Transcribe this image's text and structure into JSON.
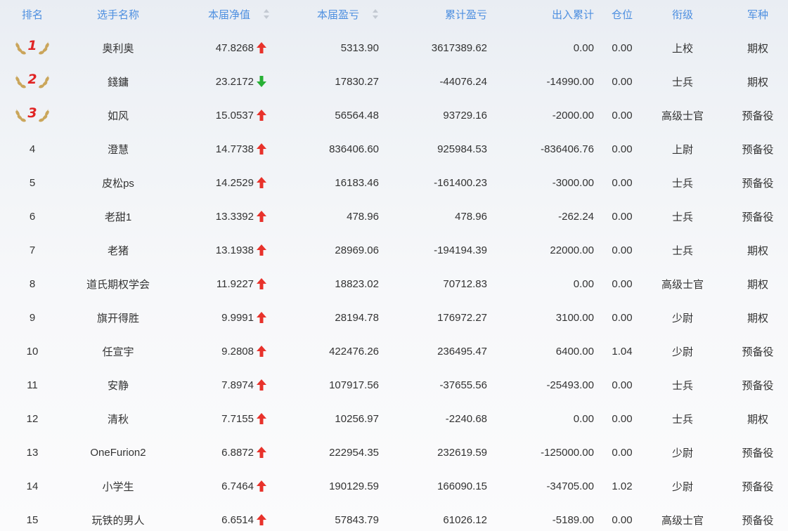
{
  "headers": {
    "rank": "排名",
    "name": "选手名称",
    "net_value": "本届净值",
    "profit_loss": "本届盈亏",
    "cumulative_pl": "累计盈亏",
    "flow": "出入累计",
    "position": "仓位",
    "military_rank": "衔级",
    "arm": "军种"
  },
  "icons": {
    "sort": "sort-icon",
    "up": "arrow-up-icon",
    "down": "arrow-down-icon",
    "medal": "laurel-medal-icon"
  },
  "colors": {
    "header_text": "#4d8fe0",
    "arrow_up": "#e8322b",
    "arrow_down": "#27b035",
    "medal_number": "#e02424",
    "laurel": "#c9a253"
  },
  "rows": [
    {
      "rank": "1",
      "name": "奥利奥",
      "net_value": "47.8268",
      "trend": "up",
      "profit_loss": "5313.90",
      "cumulative_pl": "3617389.62",
      "flow": "0.00",
      "position": "0.00",
      "military_rank": "上校",
      "arm": "期权"
    },
    {
      "rank": "2",
      "name": "錢鏞",
      "net_value": "23.2172",
      "trend": "down",
      "profit_loss": "17830.27",
      "cumulative_pl": "-44076.24",
      "flow": "-14990.00",
      "position": "0.00",
      "military_rank": "士兵",
      "arm": "期权"
    },
    {
      "rank": "3",
      "name": "如风",
      "net_value": "15.0537",
      "trend": "up",
      "profit_loss": "56564.48",
      "cumulative_pl": "93729.16",
      "flow": "-2000.00",
      "position": "0.00",
      "military_rank": "高级士官",
      "arm": "预备役"
    },
    {
      "rank": "4",
      "name": "澄慧",
      "net_value": "14.7738",
      "trend": "up",
      "profit_loss": "836406.60",
      "cumulative_pl": "925984.53",
      "flow": "-836406.76",
      "position": "0.00",
      "military_rank": "上尉",
      "arm": "预备役"
    },
    {
      "rank": "5",
      "name": "皮松ps",
      "net_value": "14.2529",
      "trend": "up",
      "profit_loss": "16183.46",
      "cumulative_pl": "-161400.23",
      "flow": "-3000.00",
      "position": "0.00",
      "military_rank": "士兵",
      "arm": "预备役"
    },
    {
      "rank": "6",
      "name": "老甜1",
      "net_value": "13.3392",
      "trend": "up",
      "profit_loss": "478.96",
      "cumulative_pl": "478.96",
      "flow": "-262.24",
      "position": "0.00",
      "military_rank": "士兵",
      "arm": "预备役"
    },
    {
      "rank": "7",
      "name": "老猪",
      "net_value": "13.1938",
      "trend": "up",
      "profit_loss": "28969.06",
      "cumulative_pl": "-194194.39",
      "flow": "22000.00",
      "position": "0.00",
      "military_rank": "士兵",
      "arm": "期权"
    },
    {
      "rank": "8",
      "name": "道氏期权学会",
      "net_value": "11.9227",
      "trend": "up",
      "profit_loss": "18823.02",
      "cumulative_pl": "70712.83",
      "flow": "0.00",
      "position": "0.00",
      "military_rank": "高级士官",
      "arm": "期权"
    },
    {
      "rank": "9",
      "name": "旗开得胜",
      "net_value": "9.9991",
      "trend": "up",
      "profit_loss": "28194.78",
      "cumulative_pl": "176972.27",
      "flow": "3100.00",
      "position": "0.00",
      "military_rank": "少尉",
      "arm": "期权"
    },
    {
      "rank": "10",
      "name": "任宣宇",
      "net_value": "9.2808",
      "trend": "up",
      "profit_loss": "422476.26",
      "cumulative_pl": "236495.47",
      "flow": "6400.00",
      "position": "1.04",
      "military_rank": "少尉",
      "arm": "预备役"
    },
    {
      "rank": "11",
      "name": "安静",
      "net_value": "7.8974",
      "trend": "up",
      "profit_loss": "107917.56",
      "cumulative_pl": "-37655.56",
      "flow": "-25493.00",
      "position": "0.00",
      "military_rank": "士兵",
      "arm": "预备役"
    },
    {
      "rank": "12",
      "name": "清秋",
      "net_value": "7.7155",
      "trend": "up",
      "profit_loss": "10256.97",
      "cumulative_pl": "-2240.68",
      "flow": "0.00",
      "position": "0.00",
      "military_rank": "士兵",
      "arm": "期权"
    },
    {
      "rank": "13",
      "name": "OneFurion2",
      "net_value": "6.8872",
      "trend": "up",
      "profit_loss": "222954.35",
      "cumulative_pl": "232619.59",
      "flow": "-125000.00",
      "position": "0.00",
      "military_rank": "少尉",
      "arm": "预备役"
    },
    {
      "rank": "14",
      "name": "小学生",
      "net_value": "6.7464",
      "trend": "up",
      "profit_loss": "190129.59",
      "cumulative_pl": "166090.15",
      "flow": "-34705.00",
      "position": "1.02",
      "military_rank": "少尉",
      "arm": "预备役"
    },
    {
      "rank": "15",
      "name": "玩铁的男人",
      "net_value": "6.6514",
      "trend": "up",
      "profit_loss": "57843.79",
      "cumulative_pl": "61026.12",
      "flow": "-5189.00",
      "position": "0.00",
      "military_rank": "高级士官",
      "arm": "预备役"
    }
  ]
}
